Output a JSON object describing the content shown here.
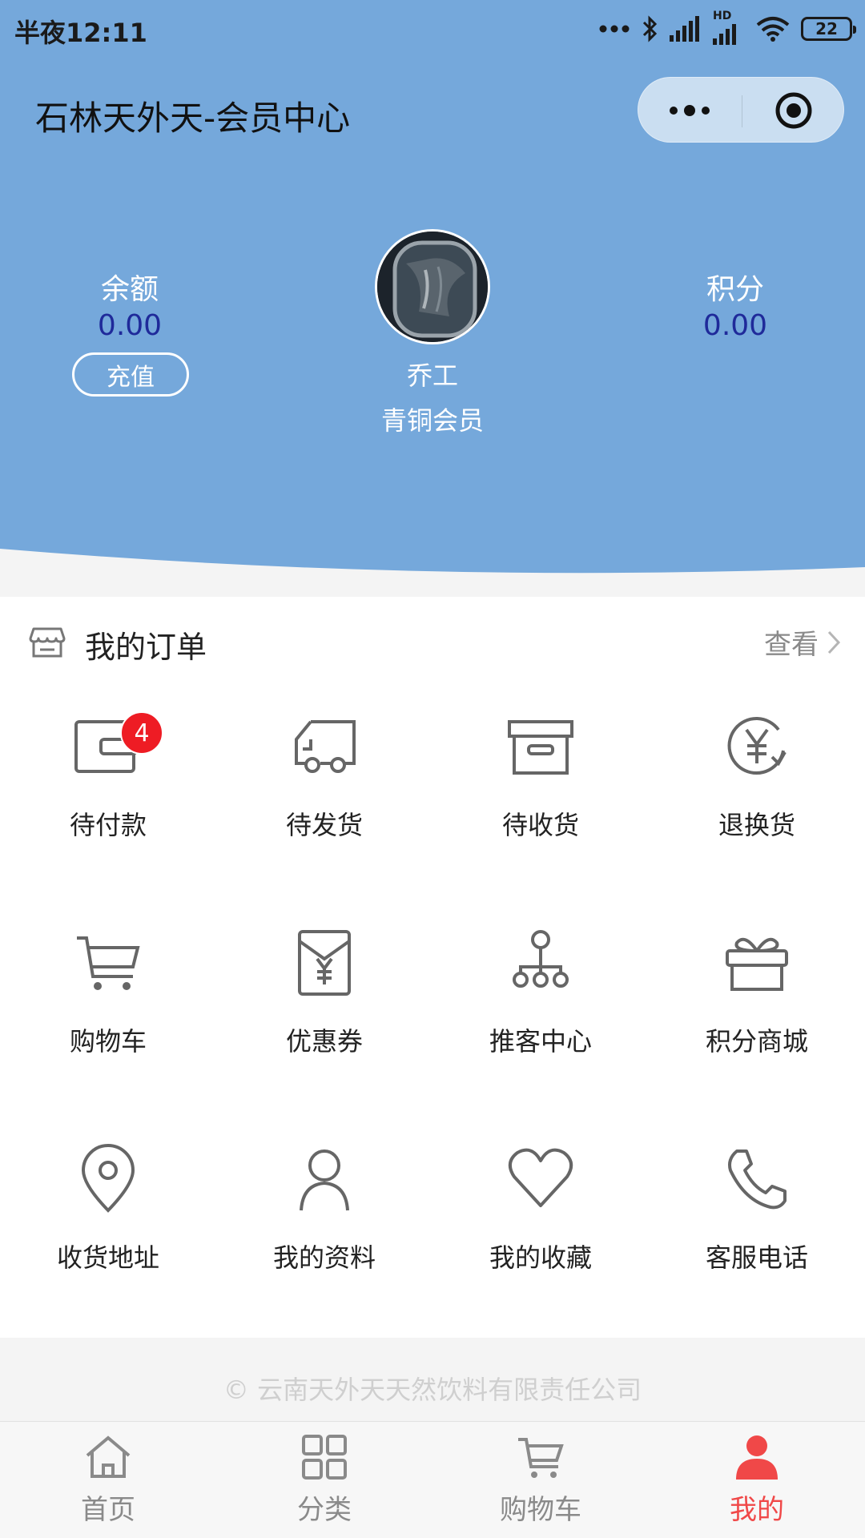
{
  "status_bar": {
    "time": "半夜12:11",
    "battery": "22",
    "network_label": "HD"
  },
  "header": {
    "title": "石林天外天-会员中心",
    "background_color": "#75a8db"
  },
  "capsule": {
    "more_icon": "more-dots-icon",
    "close_icon": "target-close-icon"
  },
  "account": {
    "balance_label": "余额",
    "balance_value": "0.00",
    "recharge_label": "充值",
    "points_label": "积分",
    "points_value": "0.00"
  },
  "user": {
    "name": "乔工",
    "level": "青铜会员",
    "avatar_icon": "avatar-photo"
  },
  "orders": {
    "title": "我的订单",
    "view_label": "查看",
    "items": [
      {
        "label": "待付款",
        "icon": "wallet-icon",
        "badge": "4"
      },
      {
        "label": "待发货",
        "icon": "truck-icon"
      },
      {
        "label": "待收货",
        "icon": "box-icon"
      },
      {
        "label": "退换货",
        "icon": "yen-refund-icon"
      },
      {
        "label": "购物车",
        "icon": "cart-icon"
      },
      {
        "label": "优惠券",
        "icon": "coupon-icon"
      },
      {
        "label": "推客中心",
        "icon": "network-icon"
      },
      {
        "label": "积分商城",
        "icon": "gift-icon"
      },
      {
        "label": "收货地址",
        "icon": "location-icon"
      },
      {
        "label": "我的资料",
        "icon": "user-icon"
      },
      {
        "label": "我的收藏",
        "icon": "heart-icon"
      },
      {
        "label": "客服电话",
        "icon": "phone-icon"
      }
    ]
  },
  "footer": {
    "copyright": "© 云南天外天天然饮料有限责任公司"
  },
  "tabbar": {
    "active_color": "#f04848",
    "items": [
      {
        "label": "首页",
        "icon": "home-icon"
      },
      {
        "label": "分类",
        "icon": "grid-icon"
      },
      {
        "label": "购物车",
        "icon": "cart-icon"
      },
      {
        "label": "我的",
        "icon": "person-icon",
        "active": true
      }
    ]
  }
}
